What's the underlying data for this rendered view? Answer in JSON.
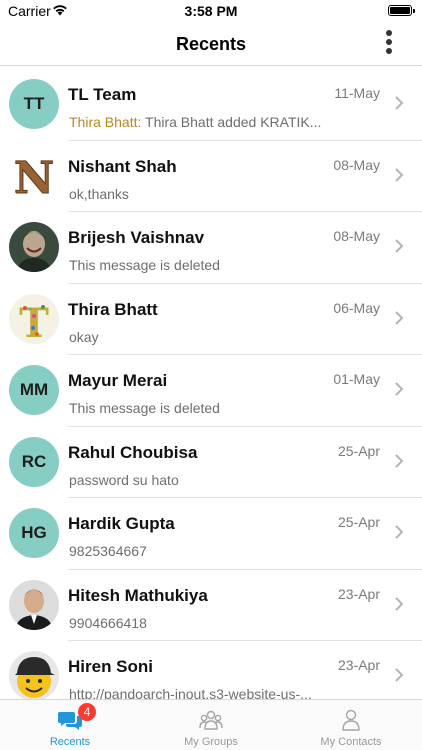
{
  "status_bar": {
    "carrier": "Carrier",
    "time": "3:58 PM"
  },
  "header": {
    "title": "Recents"
  },
  "conversations": [
    {
      "name": "TL Team",
      "date": "11-May",
      "sender": "Thira Bhatt:",
      "preview": " Thira Bhatt added KRATIK...",
      "avatar_initials": "TT"
    },
    {
      "name": "Nishant Shah",
      "date": "08-May",
      "preview": "ok,thanks",
      "avatar_letter": "N"
    },
    {
      "name": "Brijesh Vaishnav",
      "date": "08-May",
      "preview": "This message is deleted"
    },
    {
      "name": "Thira Bhatt",
      "date": "06-May",
      "preview": "okay",
      "avatar_letter": "T"
    },
    {
      "name": "Mayur Merai",
      "date": "01-May",
      "preview": "This message is deleted",
      "avatar_initials": "MM"
    },
    {
      "name": "Rahul Choubisa",
      "date": "25-Apr",
      "preview": "password su hato",
      "avatar_initials": "RC"
    },
    {
      "name": "Hardik Gupta",
      "date": "25-Apr",
      "preview": "9825364667",
      "avatar_initials": "HG"
    },
    {
      "name": "Hitesh Mathukiya",
      "date": "23-Apr",
      "preview": "9904666418"
    },
    {
      "name": "Hiren Soni",
      "date": "23-Apr",
      "preview": "http://pandoarch-inout.s3-website-us-..."
    }
  ],
  "tabs": [
    {
      "label": "Recents",
      "icon": "chat-bubbles-icon",
      "badge": "4",
      "active": true
    },
    {
      "label": "My Groups",
      "icon": "group-icon",
      "active": false
    },
    {
      "label": "My Contacts",
      "icon": "person-icon",
      "active": false
    }
  ],
  "colors": {
    "accent": "#2196d9",
    "avatar_bg": "#86cdc4",
    "sender": "#b58a1c",
    "badge": "#ff3b30"
  }
}
